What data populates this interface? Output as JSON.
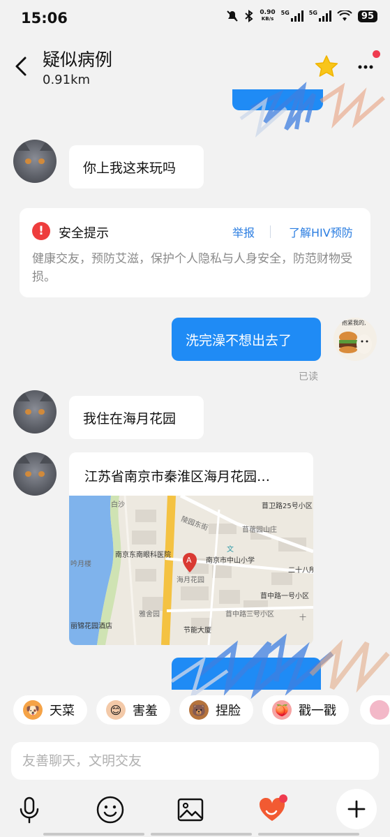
{
  "status": {
    "time": "15:06",
    "net_speed_value": "0.90",
    "net_speed_unit": "KB/s",
    "sim1_label": "5G",
    "sim2_label": "5G",
    "battery": "95"
  },
  "header": {
    "title": "疑似病例",
    "distance": "0.91km"
  },
  "messages": {
    "m1": "你上我这来玩吗",
    "m2": "洗完澡不想出去了",
    "m2_status": "已读",
    "m3": "我住在海月花园",
    "sticker_caption": "*抱紧我的,"
  },
  "safety": {
    "title": "安全提示",
    "report": "举报",
    "learn_hiv": "了解HIV预防",
    "body": "健康交友，预防艾滋，保护个人隐私与人身安全，防范财物受损。"
  },
  "location": {
    "title": "江苏省南京市秦淮区海月花园…",
    "map_labels": {
      "l1": "南京东南眼科医院",
      "l2": "南京市中山小学",
      "l3": "海月花园",
      "l4": "苜卫路25号小区",
      "l5": "苜蓿园山庄",
      "l6": "苜中路一号小区",
      "l7": "苜中路三号小区",
      "l8": "雅舍园",
      "l9": "节能大厦",
      "l10": "丽锦花园酒店",
      "l11": "二十八所",
      "l12": "吟月楼",
      "l13": "陵园东街",
      "l14": "十",
      "l15": "文",
      "l16": "白沙"
    },
    "pin_letter": "A"
  },
  "quick_replies": [
    {
      "label": "天菜",
      "icon": "corgi-icon"
    },
    {
      "label": "害羞",
      "icon": "shy-face-icon"
    },
    {
      "label": "捏脸",
      "icon": "bear-icon"
    },
    {
      "label": "戳一戳",
      "icon": "peach-icon"
    }
  ],
  "composer": {
    "placeholder": "友善聊天，文明交友"
  },
  "colors": {
    "accent": "#1f8bf5",
    "link": "#2a7de1",
    "warning": "#ee3d3d",
    "badge": "#ef3b4f"
  }
}
